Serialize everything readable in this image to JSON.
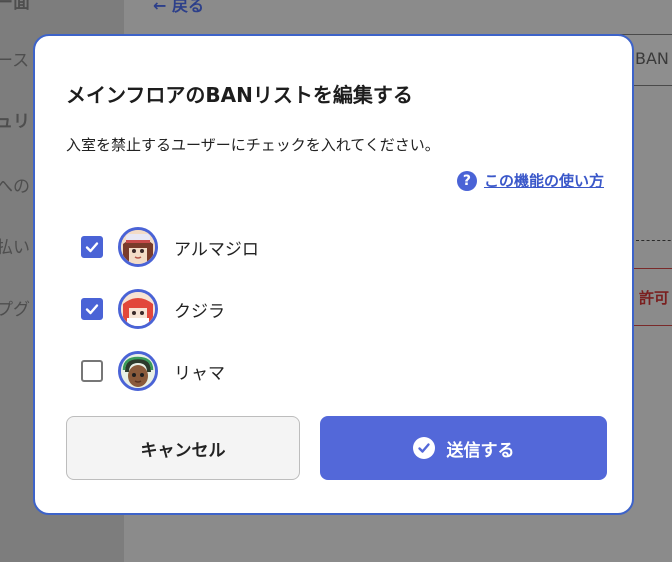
{
  "background": {
    "back_label": "← 戻る",
    "sidebar_fragments": [
      "ー面",
      "ース",
      "ュリ",
      "への",
      "払い",
      "プグ"
    ],
    "right_field_text": "BAN",
    "right_red_text": "許可"
  },
  "modal": {
    "title": "メインフロアのBANリストを編集する",
    "description": "入室を禁止するユーザーにチェックを入れてください。",
    "help": {
      "icon": "question-circle-icon",
      "label": "この機能の使い方"
    },
    "users": [
      {
        "name": "アルマジロ",
        "checked": true,
        "avatar": "avatar-brown-hair-hat"
      },
      {
        "name": "クジラ",
        "checked": true,
        "avatar": "avatar-red-hair"
      },
      {
        "name": "リャマ",
        "checked": false,
        "avatar": "avatar-dark-skin-headset"
      }
    ],
    "cancel_label": "キャンセル",
    "submit_label": "送信する",
    "submit_icon": "check-circle-icon"
  },
  "colors": {
    "accent": "#5368d9",
    "modal_border": "#3d63c9",
    "overlay": "#8a8a8a"
  }
}
